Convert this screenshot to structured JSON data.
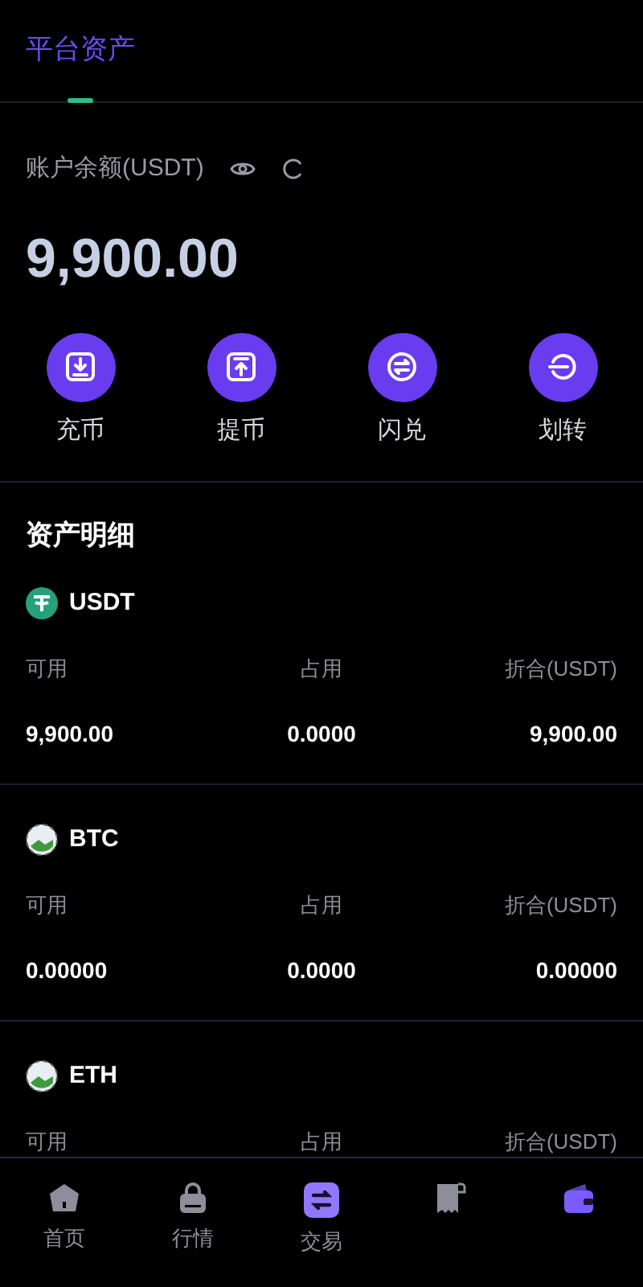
{
  "header": {
    "tabs": [
      {
        "label": "平台资产",
        "selected": true
      }
    ]
  },
  "balance": {
    "label": "账户余额(USDT)",
    "amount": "9,900.00"
  },
  "actions": [
    {
      "kind": "deposit",
      "label": "充币"
    },
    {
      "kind": "withdraw",
      "label": "提币"
    },
    {
      "kind": "swap",
      "label": "闪兑"
    },
    {
      "kind": "transfer",
      "label": "划转"
    }
  ],
  "assets_title": "资产明细",
  "assets": [
    {
      "kind": "tether",
      "name": "USDT",
      "columns": [
        "可用",
        "占用",
        "折合(USDT)"
      ],
      "values": [
        "9,900.00",
        "0.0000",
        "9,900.00"
      ]
    },
    {
      "kind": "broken-image",
      "name": "BTC",
      "columns": [
        "可用",
        "占用",
        "折合(USDT)"
      ],
      "values": [
        "0.00000",
        "0.0000",
        "0.00000"
      ]
    },
    {
      "kind": "broken-image",
      "name": "ETH",
      "columns": [
        "可用",
        "占用",
        "折合(USDT)"
      ]
    }
  ],
  "bottom_nav": [
    {
      "kind": "home",
      "label": "首页",
      "selected": false
    },
    {
      "kind": "market",
      "label": "行情",
      "selected": false
    },
    {
      "kind": "trade",
      "label": "交易",
      "selected": false
    },
    {
      "kind": "orders",
      "selected": false
    },
    {
      "kind": "wallet",
      "selected": true
    }
  ]
}
